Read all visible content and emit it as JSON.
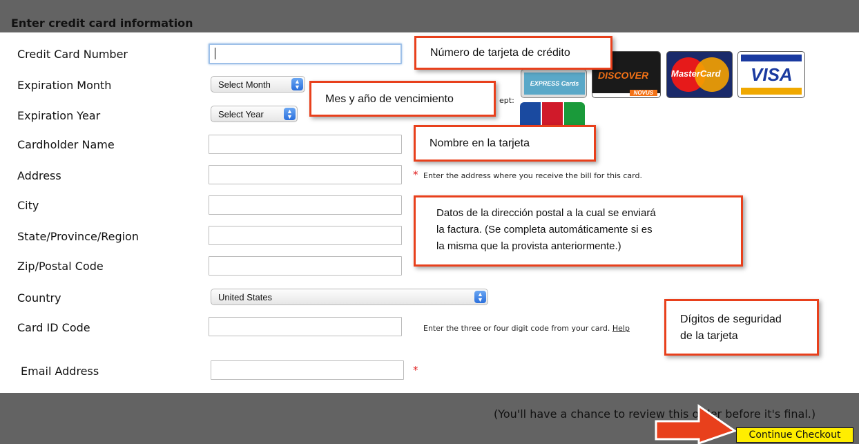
{
  "section_title": "Enter credit card information",
  "labels": {
    "card_number": "Credit Card Number",
    "exp_month": "Expiration Month",
    "exp_year": "Expiration Year",
    "cardholder": "Cardholder Name",
    "address": "Address",
    "city": "City",
    "state": "State/Province/Region",
    "zip": "Zip/Postal Code",
    "country": "Country",
    "card_id": "Card ID Code",
    "email": "Email Address"
  },
  "selects": {
    "month": "Select Month",
    "year": "Select Year",
    "country": "United States"
  },
  "notes": {
    "address": "Enter the address where you receive the bill for this card.",
    "card_id": "Enter the three or four digit code from your card.",
    "help_link": "Help",
    "accept_partial": "ept:"
  },
  "logos": {
    "amex": "EXPRESS Cards",
    "discover": "DISCOVER",
    "novus": "NOVUS",
    "mastercard": "MasterCard",
    "visa": "VISA"
  },
  "callouts": {
    "card_number": "Número de tarjeta de crédito",
    "expiration": "Mes y año de vencimiento",
    "name": "Nombre en la tarjeta",
    "address_l1": "Datos de la dirección postal a la cual se enviará",
    "address_l2": "la factura. (Se completa automáticamente si es",
    "address_l3": "la misma que la provista anteriormente.)",
    "security_l1": "Dígitos de seguridad",
    "security_l2": "de la tarjeta"
  },
  "footer": {
    "review_note": "(You'll have a chance to review this order before it's final.)",
    "continue_button": "Continue Checkout"
  },
  "colors": {
    "header_bg": "#636363",
    "callout_border": "#e8401c",
    "button_bg": "#ffee00",
    "required_star": "#e02020"
  }
}
